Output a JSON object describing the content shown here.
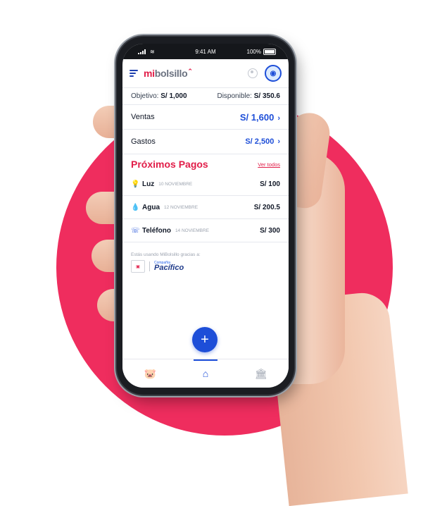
{
  "status": {
    "time": "9:41 AM",
    "battery": "100%"
  },
  "app": {
    "logo_mi": "mi",
    "logo_bolsillo": "bolsillo"
  },
  "summary": {
    "objetivo_label": "Objetivo:",
    "objetivo_value": "S/ 1,000",
    "disponible_label": "Disponible:",
    "disponible_value": "S/ 350.6"
  },
  "rows": {
    "ventas_label": "Ventas",
    "ventas_value": "S/ 1,600",
    "gastos_label": "Gastos",
    "gastos_value": "S/ 2,500"
  },
  "pagos": {
    "title": "Próximos Pagos",
    "ver_todos": "Ver todos",
    "items": [
      {
        "name": "Luz",
        "date": "10 NOVIEMBRE",
        "amount": "S/ 100",
        "icon": "bulb-icon"
      },
      {
        "name": "Agua",
        "date": "12 NOVIEMBRE",
        "amount": "S/ 200.5",
        "icon": "water-drop-icon"
      },
      {
        "name": "Teléfono",
        "date": "14 NOVIEMBRE",
        "amount": "S/ 300",
        "icon": "phone-icon"
      }
    ]
  },
  "sponsor": {
    "text": "Estás usando MiBolsillo gracias a:",
    "pacifico_small": "Compañía",
    "pacifico": "Pacífico"
  },
  "fab": {
    "label": "+"
  },
  "nav": [
    "piggy-bank-icon",
    "home-icon",
    "bank-icon"
  ],
  "colors": {
    "accent_blue": "#1d4ed8",
    "accent_pink": "#e11d48",
    "background_circle": "#ef2d5e"
  }
}
